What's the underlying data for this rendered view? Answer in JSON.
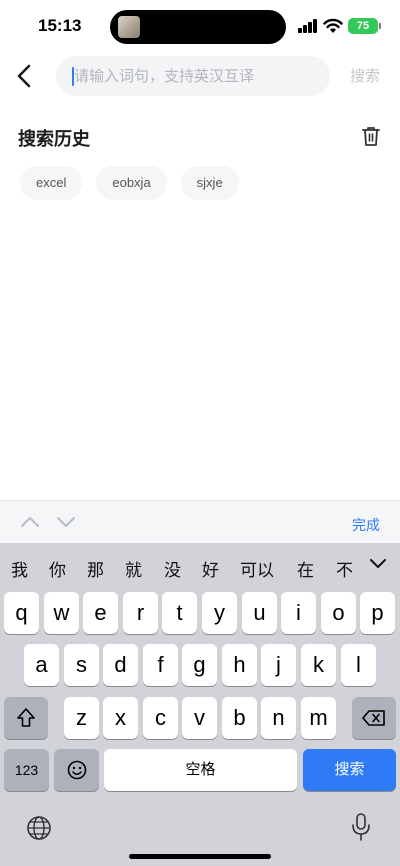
{
  "status_bar": {
    "time": "15:13",
    "battery": "75"
  },
  "header": {
    "search_placeholder": "请输入词句，支持英汉互译",
    "search_value": "",
    "search_button": "搜索"
  },
  "history": {
    "title": "搜索历史",
    "items": [
      "excel",
      "eobxja",
      "sjxje"
    ]
  },
  "keyboard_toolbar": {
    "done_label": "完成"
  },
  "keyboard": {
    "candidates": [
      "我",
      "你",
      "那",
      "就",
      "没",
      "好",
      "可以",
      "在",
      "不"
    ],
    "row1": [
      "q",
      "w",
      "e",
      "r",
      "t",
      "y",
      "u",
      "i",
      "o",
      "p"
    ],
    "row2": [
      "a",
      "s",
      "d",
      "f",
      "g",
      "h",
      "j",
      "k",
      "l"
    ],
    "row3": [
      "z",
      "x",
      "c",
      "v",
      "b",
      "n",
      "m"
    ],
    "numbers_key": "123",
    "space_label": "空格",
    "search_key": "搜索"
  },
  "colors": {
    "accent": "#2f7bf5",
    "battery": "#34c759",
    "keyboard_bg": "#d1d3d9"
  },
  "icons": [
    "back-chevron-icon",
    "trash-icon",
    "shift-icon",
    "backspace-icon",
    "emoji-icon",
    "globe-icon",
    "microphone-icon"
  ]
}
